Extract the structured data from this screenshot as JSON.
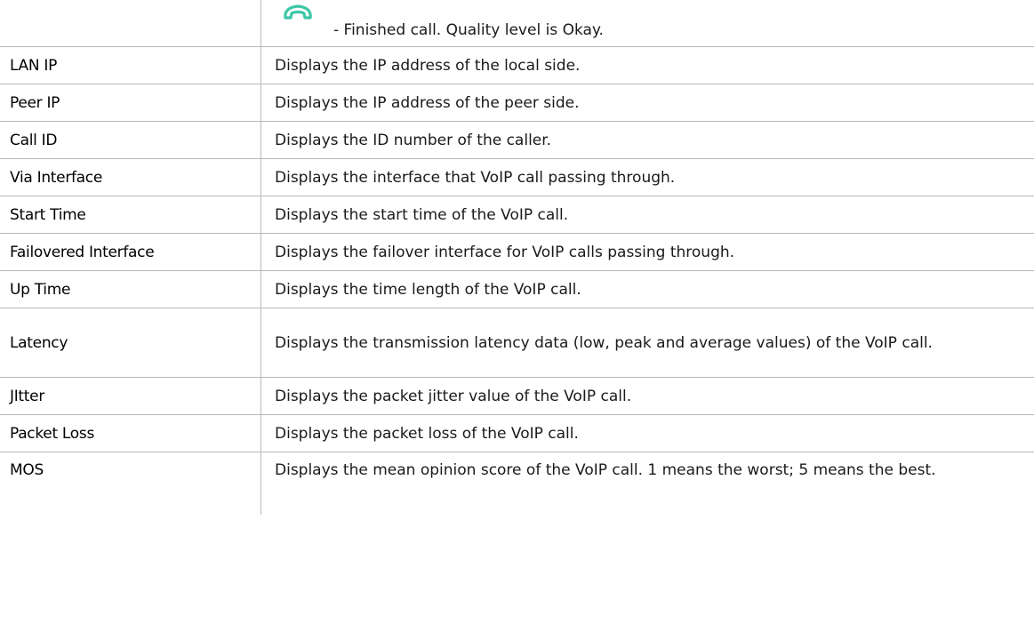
{
  "legend_row": {
    "icon": "finished-call-okay-icon",
    "icon_color": "#3cc7a6",
    "text": "- Finished call. Quality level is Okay."
  },
  "rows": [
    {
      "term": "LAN IP",
      "desc": "Displays the IP address of the local side."
    },
    {
      "term": "Peer IP",
      "desc": "Displays the IP address of the peer side."
    },
    {
      "term": "Call ID",
      "desc": "Displays the ID number of the caller."
    },
    {
      "term": "Via Interface",
      "desc": "Displays the interface that VoIP call passing through."
    },
    {
      "term": "Start Time",
      "desc": "Displays the start time of the VoIP call."
    },
    {
      "term": "Failovered Interface",
      "desc": "Displays the failover interface for VoIP calls passing through."
    },
    {
      "term": "Up Time",
      "desc": "Displays the time length of the VoIP call."
    },
    {
      "term": "Latency",
      "desc": "Displays the transmission latency data (low, peak and average values) of the VoIP call."
    },
    {
      "term": "JItter",
      "desc": "Displays the packet jitter value of the VoIP call."
    },
    {
      "term": "Packet Loss",
      "desc": "Displays the packet loss of the VoIP call."
    },
    {
      "term": "MOS",
      "desc": "Displays the mean opinion score of the VoIP call. 1 means the worst; 5 means the best."
    }
  ]
}
